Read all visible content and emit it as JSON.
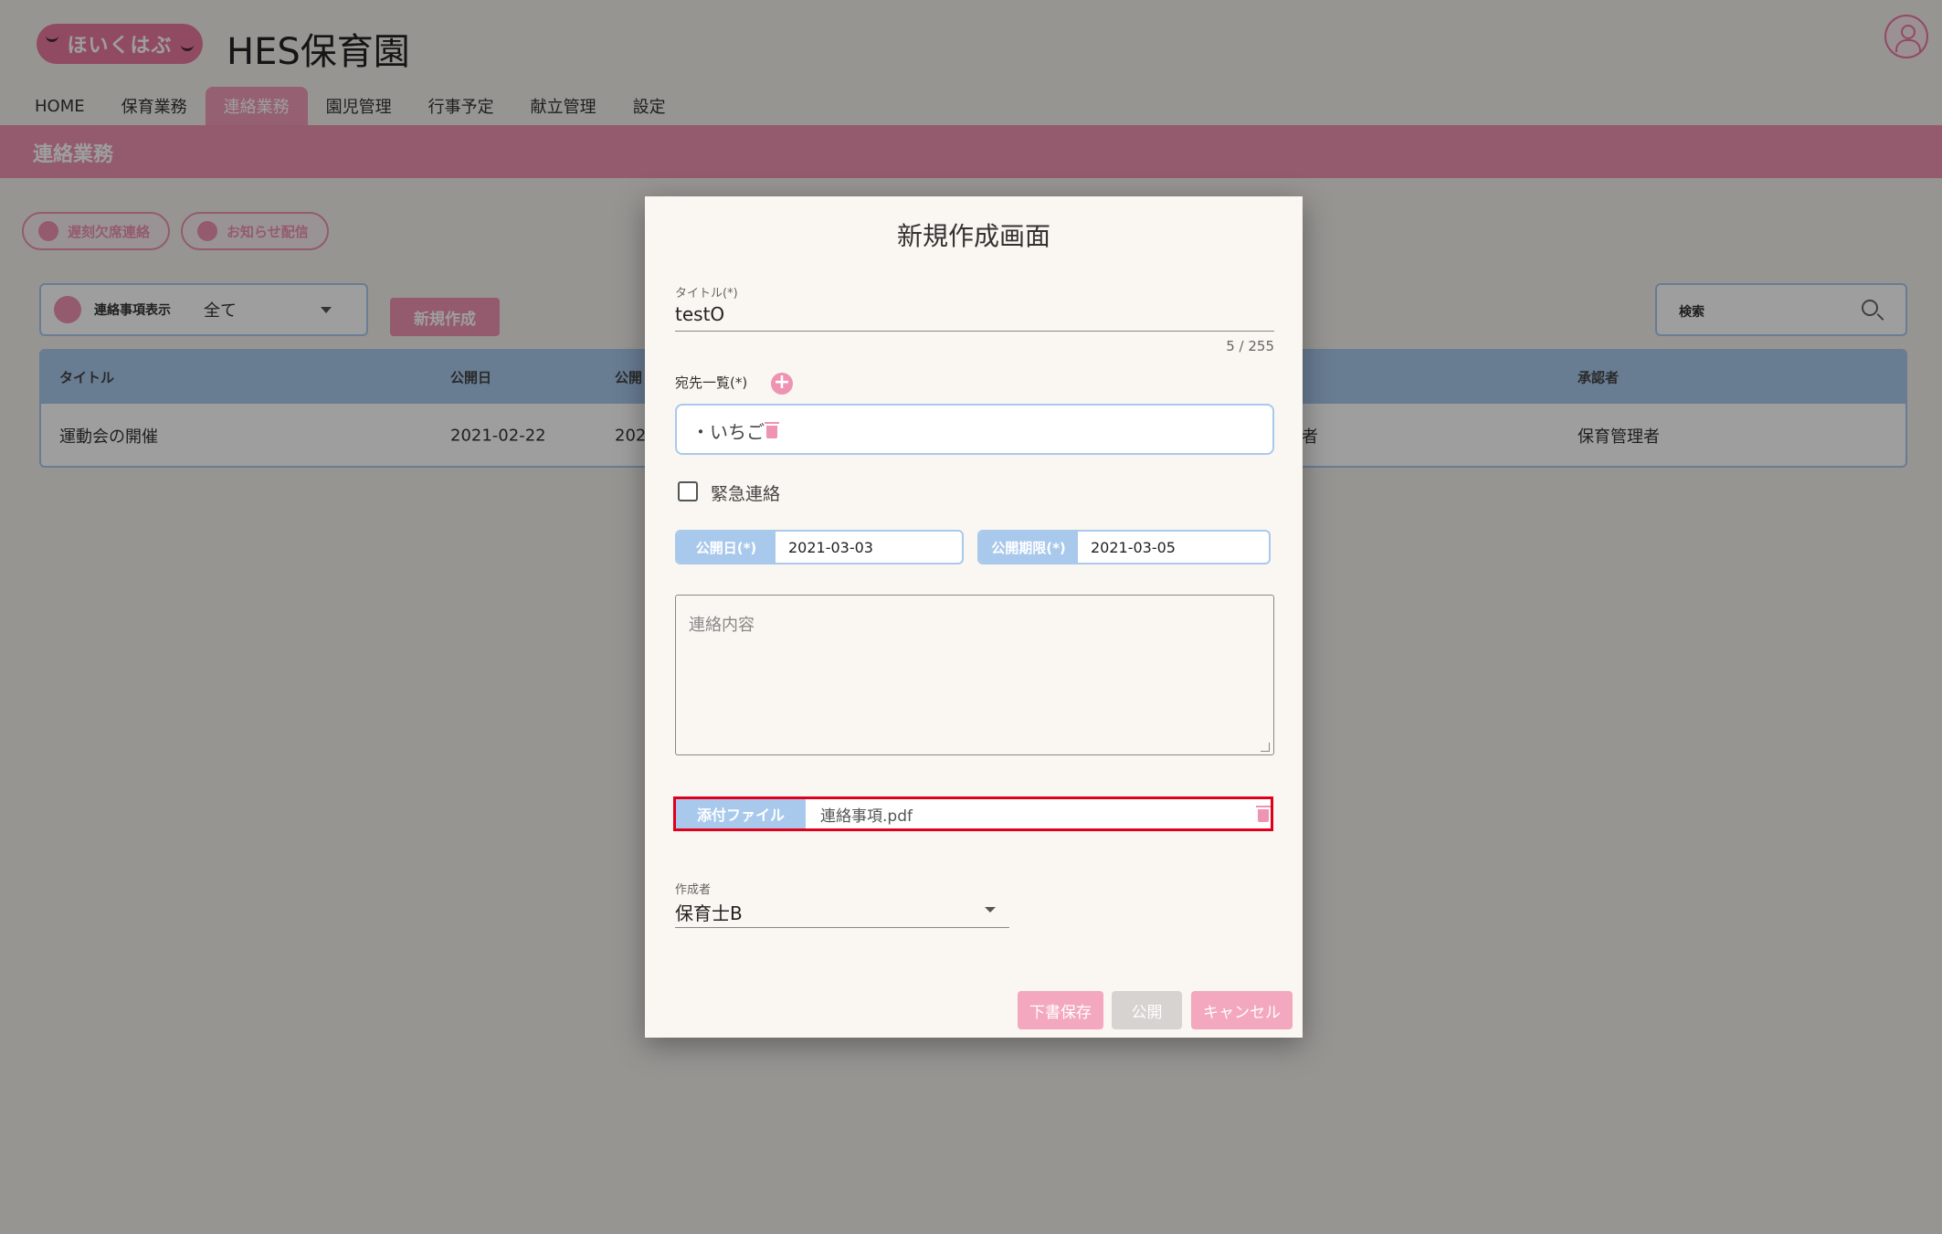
{
  "header": {
    "logo_text": "ほいくはぶ",
    "site_title": "HES保育園"
  },
  "nav": {
    "tabs": [
      {
        "label": "HOME"
      },
      {
        "label": "保育業務"
      },
      {
        "label": "連絡業務"
      },
      {
        "label": "園児管理"
      },
      {
        "label": "行事予定"
      },
      {
        "label": "献立管理"
      },
      {
        "label": "設定"
      }
    ],
    "active_index": 2
  },
  "section": {
    "title": "連絡業務"
  },
  "actions": {
    "absence_label": "遅刻欠席連絡",
    "notice_label": "お知らせ配信",
    "filter_label": "連絡事項表示",
    "filter_value": "全て",
    "new_label": "新規作成",
    "search_placeholder": "検索"
  },
  "table": {
    "headers": [
      "タイトル",
      "公開日",
      "公開",
      "承認者"
    ],
    "rows": [
      {
        "title": "運動会の開催",
        "publish_date": "2021-02-22",
        "col3": "202",
        "col4": "者",
        "approver": "保育管理者"
      }
    ]
  },
  "modal": {
    "title": "新規作成画面",
    "title_field": {
      "label": "タイトル(*)",
      "value": "testO",
      "counter": "5 / 255"
    },
    "destinations": {
      "label": "宛先一覧(*)",
      "items": [
        "・いちご"
      ]
    },
    "urgent": {
      "label": "緊急連絡",
      "checked": false
    },
    "publish_date": {
      "label": "公開日(*)",
      "value": "2021-03-03"
    },
    "publish_limit": {
      "label": "公開期限(*)",
      "value": "2021-03-05"
    },
    "content": {
      "placeholder": "連絡内容"
    },
    "attachment": {
      "label": "添付ファイル",
      "filename": "連絡事項.pdf"
    },
    "author": {
      "label": "作成者",
      "value": "保育士B"
    },
    "buttons": {
      "draft": "下書保存",
      "publish": "公開",
      "cancel": "キャンセル"
    }
  },
  "colors": {
    "brand_pink": "#ee93b1",
    "accent_blue": "#a9c9ec",
    "highlight_red": "#e0001b"
  }
}
